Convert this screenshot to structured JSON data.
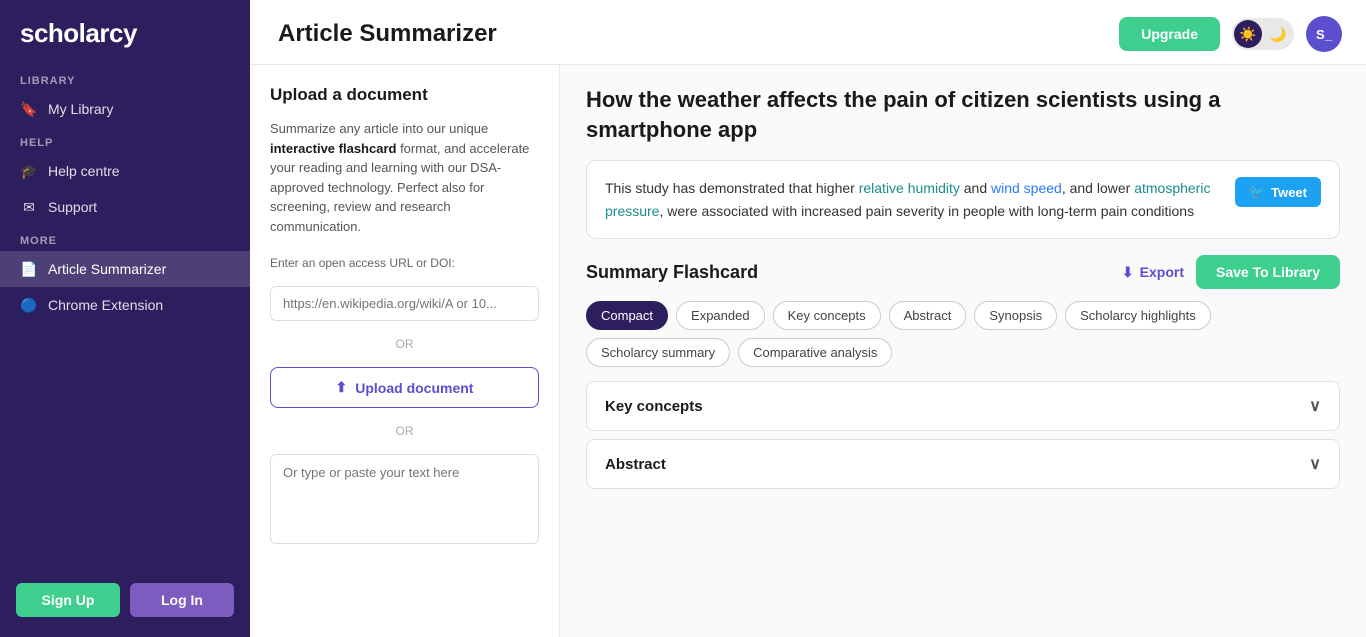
{
  "sidebar": {
    "logo": "scholarcy",
    "sections": [
      {
        "label": "LIBRARY",
        "items": [
          {
            "id": "my-library",
            "icon": "🔖",
            "text": "My Library",
            "active": false
          }
        ]
      },
      {
        "label": "HELP",
        "items": [
          {
            "id": "help-centre",
            "icon": "🎓",
            "text": "Help centre",
            "active": false
          },
          {
            "id": "support",
            "icon": "✉",
            "text": "Support",
            "active": false
          }
        ]
      },
      {
        "label": "MORE",
        "items": [
          {
            "id": "article-summarizer",
            "icon": "📄",
            "text": "Article Summarizer",
            "active": true
          },
          {
            "id": "chrome-extension",
            "icon": "🔵",
            "text": "Chrome Extension",
            "active": false
          }
        ]
      }
    ],
    "signup_label": "Sign Up",
    "login_label": "Log In"
  },
  "topbar": {
    "title": "Article Summarizer",
    "upgrade_label": "Upgrade",
    "avatar_initials": "S_"
  },
  "left_panel": {
    "section_title": "Upload a document",
    "description_plain": "Summarize any article into our unique ",
    "description_bold": "interactive flashcard",
    "description_rest": " format, and accelerate your reading and learning with our DSA-approved technology. Perfect also for screening, review and research communication.",
    "url_label": "Enter an open access URL or DOI:",
    "url_placeholder": "https://en.wikipedia.org/wiki/A or 10...",
    "or_text": "OR",
    "upload_button_label": "Upload document",
    "or_text2": "OR",
    "textarea_placeholder": "Or type or paste your text here"
  },
  "right_panel": {
    "article_title": "How the weather affects the pain of citizen scientists using a smartphone app",
    "summary_text_1": "This study has demonstrated that higher ",
    "summary_link_1": "relative humidity",
    "summary_text_2": " and ",
    "summary_link_2": "wind speed",
    "summary_text_3": ", and lower ",
    "summary_link_3": "atmospheric pressure",
    "summary_text_4": ", were associated with increased pain severity in people with long-term pain conditions",
    "tweet_label": "Tweet",
    "flashcard_title": "Summary Flashcard",
    "export_label": "Export",
    "save_library_label": "Save To Library",
    "tabs": [
      {
        "id": "compact",
        "label": "Compact",
        "active": true
      },
      {
        "id": "expanded",
        "label": "Expanded",
        "active": false
      },
      {
        "id": "key-concepts",
        "label": "Key concepts",
        "active": false
      },
      {
        "id": "abstract",
        "label": "Abstract",
        "active": false
      },
      {
        "id": "synopsis",
        "label": "Synopsis",
        "active": false
      },
      {
        "id": "scholarcy-highlights",
        "label": "Scholarcy highlights",
        "active": false
      },
      {
        "id": "scholarcy-summary",
        "label": "Scholarcy summary",
        "active": false
      },
      {
        "id": "comparative-analysis",
        "label": "Comparative analysis",
        "active": false
      }
    ],
    "accordion_items": [
      {
        "id": "key-concepts-section",
        "label": "Key concepts",
        "open": true
      },
      {
        "id": "abstract-section",
        "label": "Abstract",
        "open": false
      }
    ]
  }
}
